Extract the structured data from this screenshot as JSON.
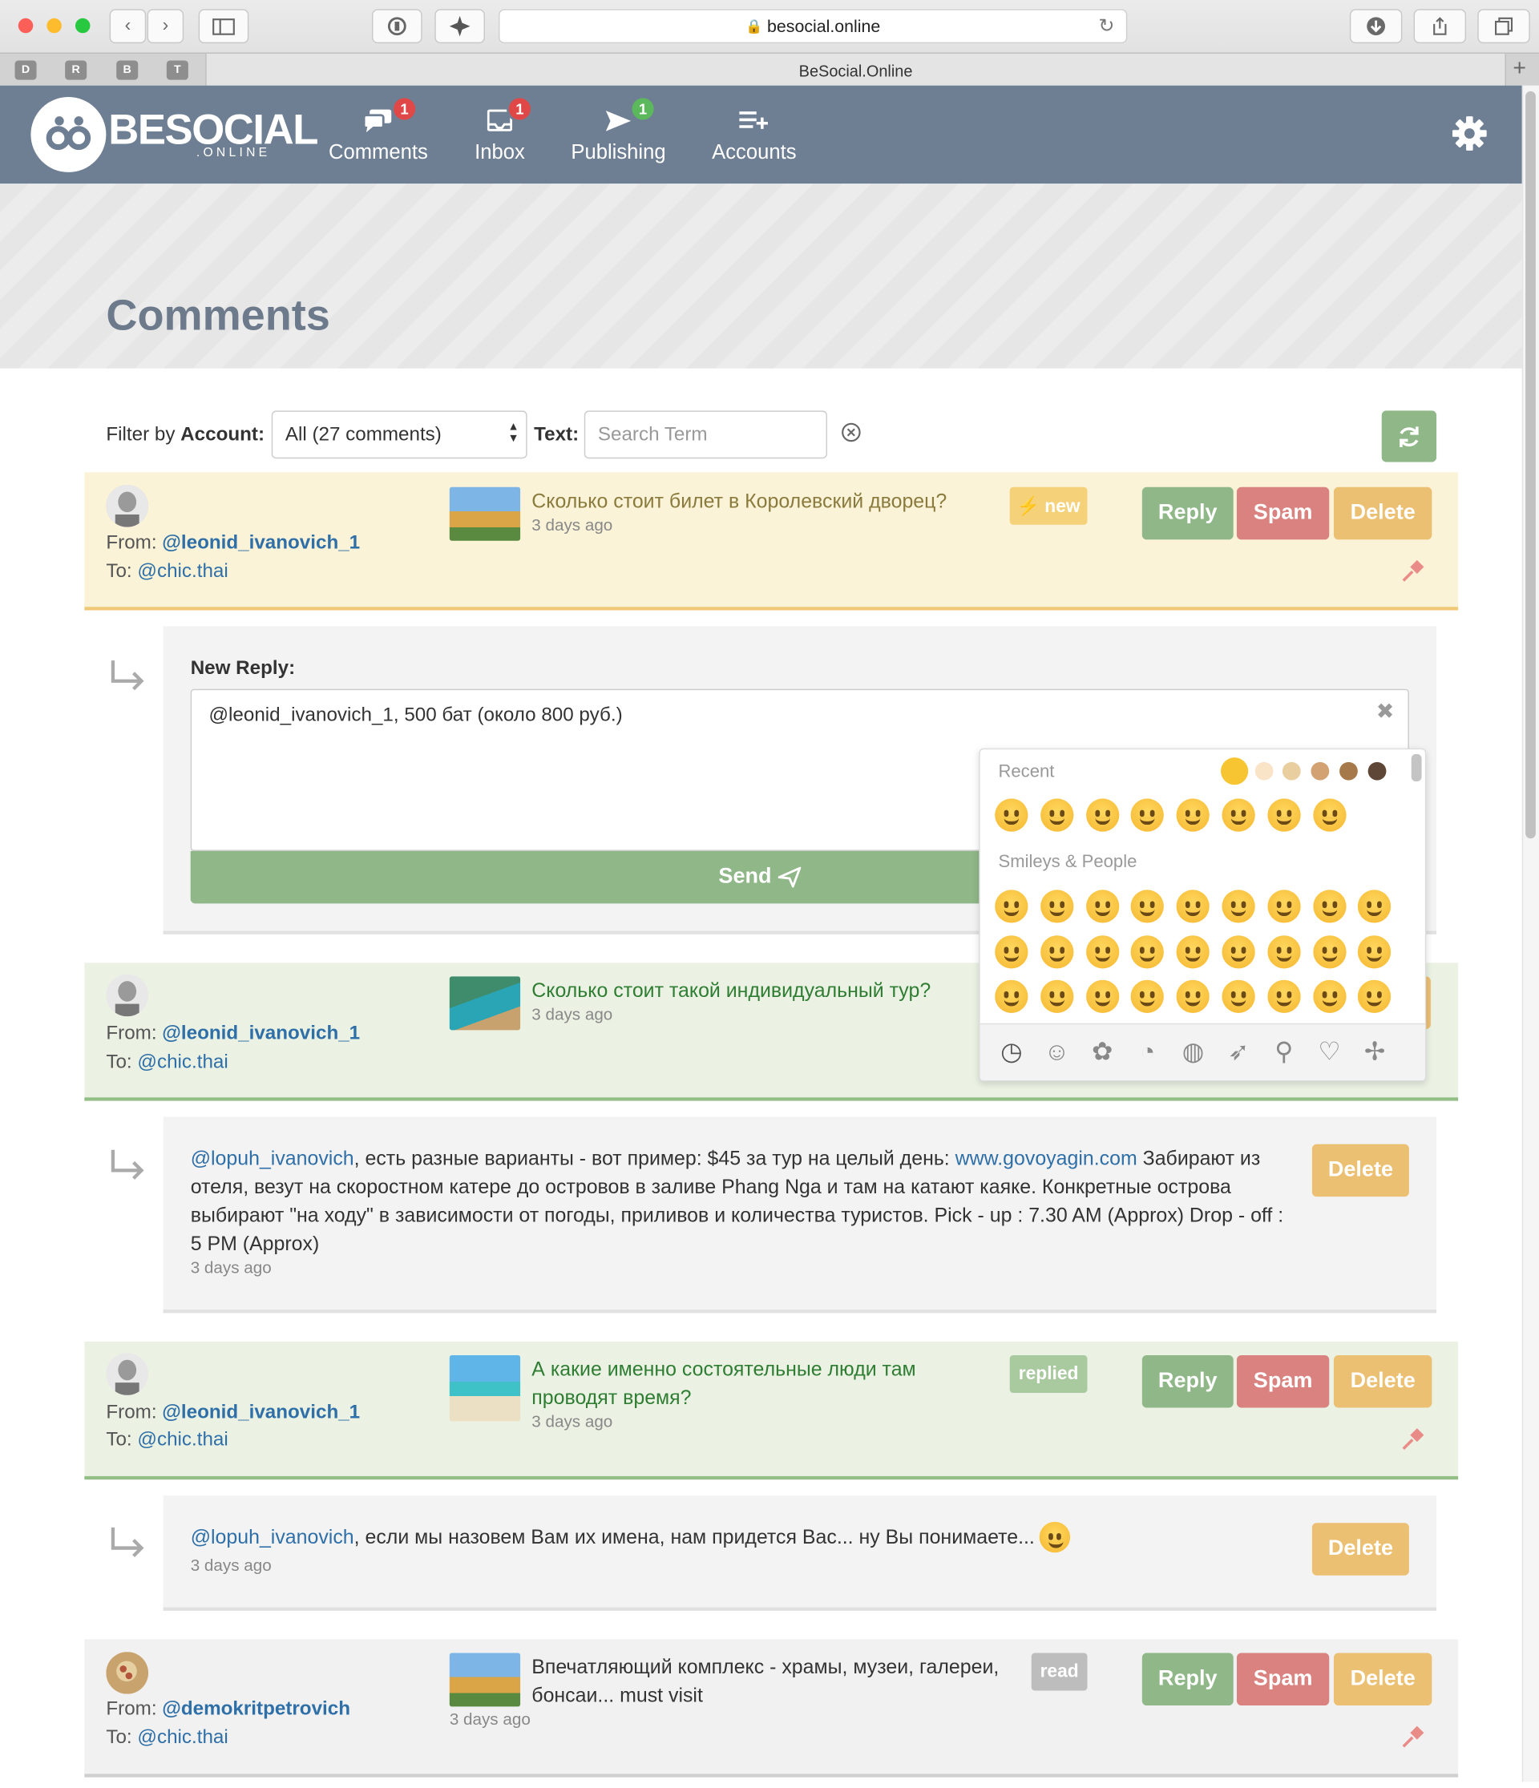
{
  "browser": {
    "url": "besocial.online",
    "tab_title": "BeSocial.Online",
    "bookmarks": [
      "D",
      "R",
      "B",
      "T"
    ]
  },
  "nav": {
    "logo": "BESOCIAL",
    "logo_sub": ".ONLINE",
    "items": [
      {
        "label": "Comments",
        "badge": "1",
        "badge_color": "#e04848"
      },
      {
        "label": "Inbox",
        "badge": "1",
        "badge_color": "#e04848"
      },
      {
        "label": "Publishing",
        "badge": "1",
        "badge_color": "#5cb85c"
      },
      {
        "label": "Accounts",
        "badge": ""
      }
    ]
  },
  "page": {
    "title": "Comments"
  },
  "filter": {
    "by_label": "Filter by",
    "account_label": "Account:",
    "account_value": "All (27 comments)",
    "text_label": "Text:",
    "search_placeholder": "Search Term"
  },
  "comments": [
    {
      "from_label": "From:",
      "from": "@leonid_ivanovich_1",
      "to_label": "To:",
      "to": "@chic.thai",
      "text": "Сколько стоит билет в Королевский дворец?",
      "time": "3 days ago",
      "status": "⚡ new",
      "reply_label": "Reply",
      "spam_label": "Spam",
      "delete_label": "Delete"
    },
    {
      "from_label": "From:",
      "from": "@leonid_ivanovich_1",
      "to_label": "To:",
      "to": "@chic.thai",
      "text": "Сколько стоит такой индивидуальный тур?",
      "time": "3 days ago"
    },
    {
      "from_label": "From:",
      "from": "@leonid_ivanovich_1",
      "to_label": "To:",
      "to": "@chic.thai",
      "text_line1": "А какие именно состоятельные люди там",
      "text_line2": "проводят время?",
      "time": "3 days ago",
      "status": "replied",
      "reply_label": "Reply",
      "spam_label": "Spam",
      "delete_label": "Delete"
    },
    {
      "from_label": "From:",
      "from": "@demokritpetrovich",
      "to_label": "To:",
      "to": "@chic.thai",
      "text_line1": "Впечатляющий комплекс - храмы, музеи, галереи,",
      "text_line2": "бонсаи... must visit",
      "time": "3 days ago",
      "status": "read",
      "reply_label": "Reply",
      "spam_label": "Spam",
      "delete_label": "Delete"
    }
  ],
  "new_reply": {
    "label": "New Reply:",
    "value": "@leonid_ivanovich_1, 500 бат (около 800 руб.)",
    "send_label": "Send"
  },
  "replies": [
    {
      "mention": "@lopuh_ivanovich",
      "part1": ", есть разные варианты - вот пример: $45 за тур на целый день: ",
      "link": "www.govoyagin.com",
      "part2": " Забирают из",
      "line2": "отеля, везут на скоростном катере до островов в заливе Phang Nga и там на катают каяке. Конкретные острова",
      "line3": "выбирают \"на ходу\" в зависимости от погоды, приливов и количества туристов. Pick - up : 7.30 AM (Approx) Drop - off :",
      "line4": "5 PM (Approx)",
      "time": "3 days ago",
      "delete_label": "Delete"
    },
    {
      "mention": "@lopuh_ivanovich",
      "text": ", если мы назовем Вам их имена, нам придется Вас... ну Вы понимаете...",
      "time": "3 days ago",
      "delete_label": "Delete"
    }
  ],
  "emoji_picker": {
    "recent_label": "Recent",
    "section_label": "Smileys & People",
    "tones": [
      "#f7c531",
      "#f9e4c8",
      "#e9cfa0",
      "#d3a273",
      "#a6794b",
      "#5e4736"
    ],
    "categories": [
      "clock-icon",
      "smiley-icon",
      "animal-icon",
      "food-icon",
      "ball-icon",
      "rocket-icon",
      "bulb-icon",
      "heart-icon",
      "flag-icon"
    ]
  }
}
